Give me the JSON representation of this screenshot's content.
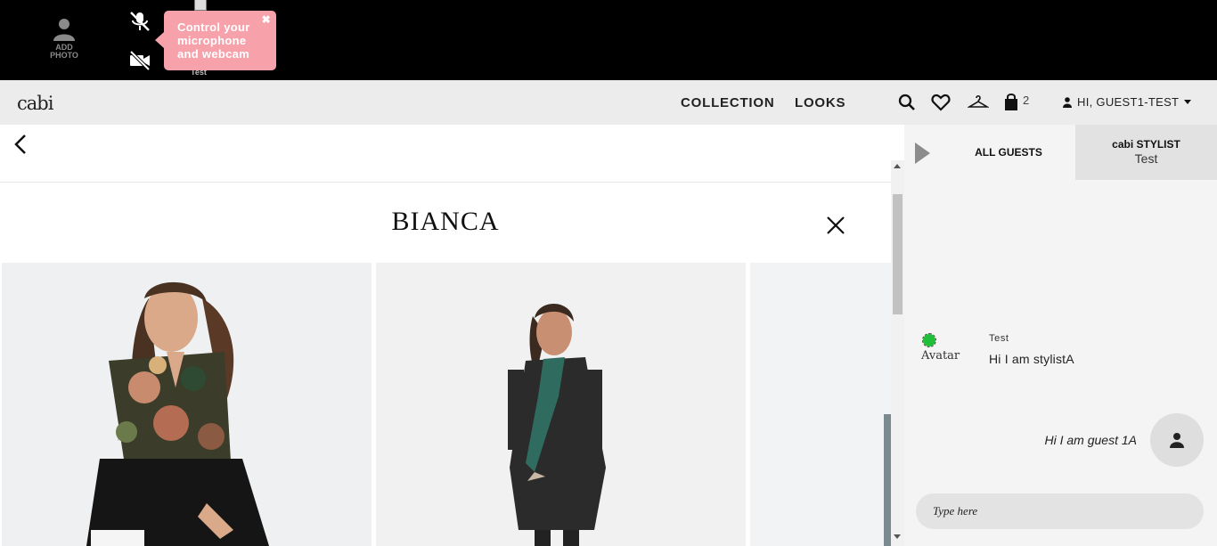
{
  "topbar": {
    "add_photo_label": "ADD PHOTO",
    "tiny_label": "Test",
    "tooltip": {
      "text": "Control your microphone and webcam",
      "close_glyph": "✖"
    },
    "icons": [
      "person-icon",
      "microphone-off-icon",
      "camera-off-icon"
    ]
  },
  "navbar": {
    "logo": "cabi",
    "links": [
      "COLLECTION",
      "LOOKS"
    ],
    "bag_count": "2",
    "user_greeting": "HI, GUEST1-TEST",
    "icons": [
      "search-icon",
      "heart-icon",
      "hanger-icon",
      "bag-icon",
      "user-icon",
      "caret-down-icon"
    ]
  },
  "look": {
    "title": "BIANCA"
  },
  "chat": {
    "tabs": {
      "all_guests": "ALL GUESTS",
      "stylist_title": "cabi STYLIST",
      "stylist_name": "Test"
    },
    "messages": [
      {
        "avatar_alt": "Avatar",
        "sender": "Test",
        "text": "Hi I am stylistA"
      },
      {
        "text": "Hi I am guest 1A"
      }
    ],
    "input_placeholder": "Type here"
  },
  "colors": {
    "topbar_bg": "#000000",
    "navbar_bg": "#ececec",
    "tooltip_bg": "#f7a1ab",
    "chat_bg": "#f4f4f4",
    "online_dot": "#1fbf3a"
  }
}
